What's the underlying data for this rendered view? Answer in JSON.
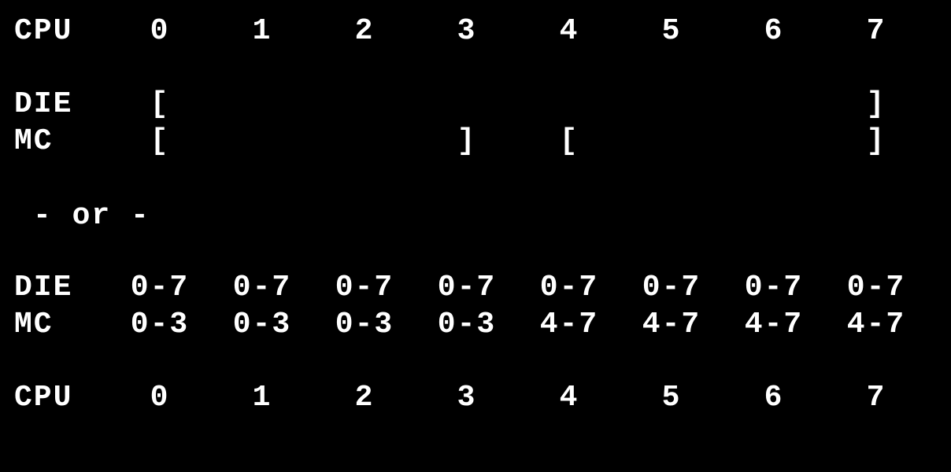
{
  "labels": {
    "cpu": "CPU",
    "die": "DIE",
    "mc": "MC"
  },
  "cpu_ids": [
    "0",
    "1",
    "2",
    "3",
    "4",
    "5",
    "6",
    "7"
  ],
  "brackets": {
    "die": [
      "[",
      "",
      "",
      "",
      "",
      "",
      "",
      "]"
    ],
    "mc": [
      "[",
      "",
      "",
      "]",
      "[",
      "",
      "",
      "]"
    ]
  },
  "or_text": " - or -",
  "ranges": {
    "die": [
      "0-7",
      "0-7",
      "0-7",
      "0-7",
      "0-7",
      "0-7",
      "0-7",
      "0-7"
    ],
    "mc": [
      "0-3",
      "0-3",
      "0-3",
      "0-3",
      "4-7",
      "4-7",
      "4-7",
      "4-7"
    ]
  }
}
